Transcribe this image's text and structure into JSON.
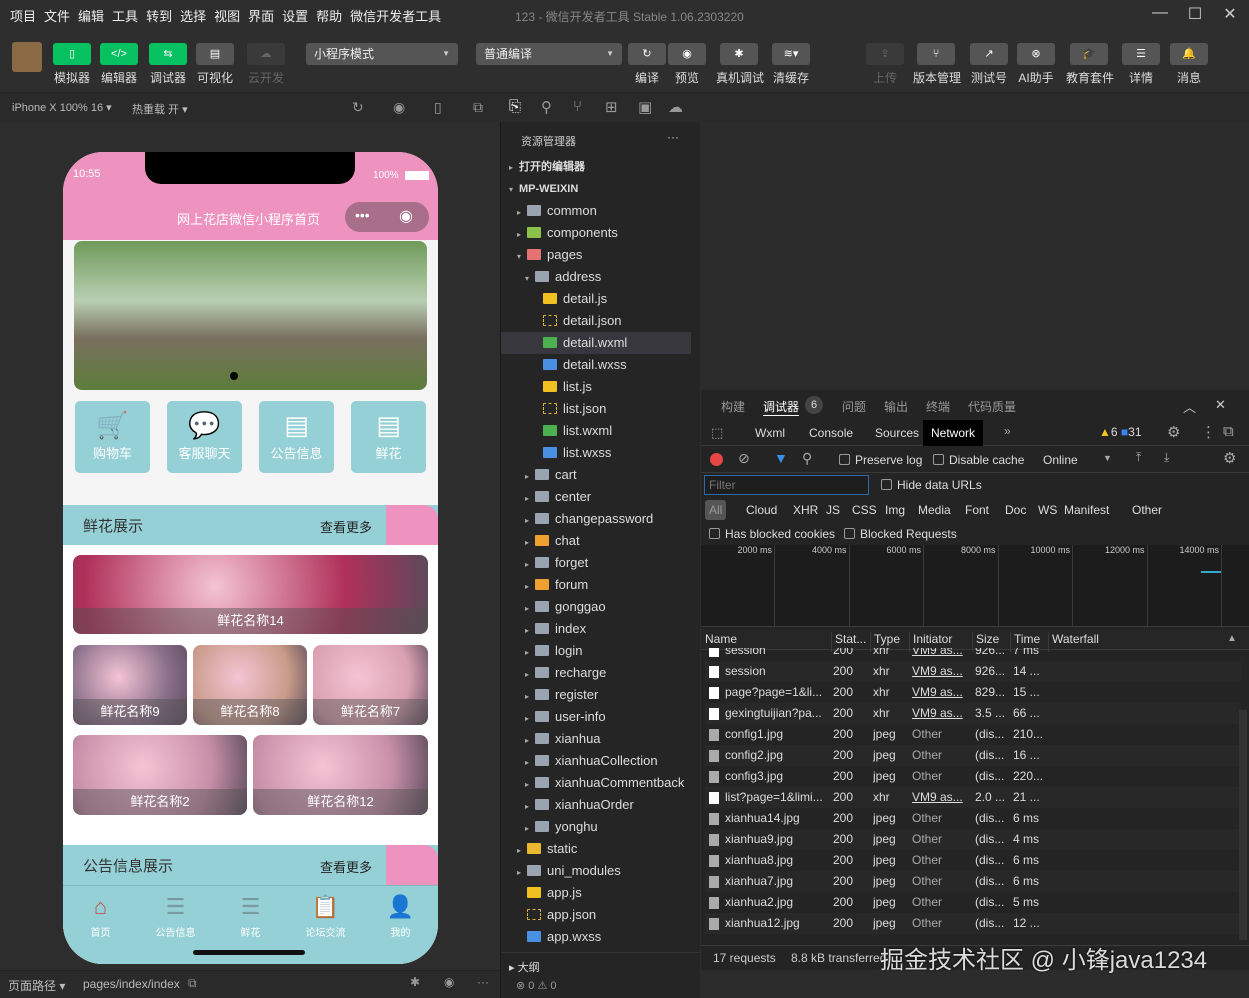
{
  "menu": [
    "项目",
    "文件",
    "编辑",
    "工具",
    "转到",
    "选择",
    "视图",
    "界面",
    "设置",
    "帮助",
    "微信开发者工具"
  ],
  "window_title": "123 - 微信开发者工具 Stable 1.06.2303220",
  "toolbar": {
    "left": [
      {
        "label": "模拟器",
        "icon": "phone-icon",
        "green": true
      },
      {
        "label": "编辑器",
        "icon": "code-icon",
        "green": true
      },
      {
        "label": "调试器",
        "icon": "debug-icon",
        "green": true
      },
      {
        "label": "可视化",
        "icon": "layout-icon"
      },
      {
        "label": "云开发",
        "icon": "cloud-icon",
        "disabled": true
      }
    ],
    "mode_select": "小程序模式",
    "compile_select": "普通编译",
    "mid": [
      {
        "label": "编译",
        "icon": "refresh-icon"
      },
      {
        "label": "预览",
        "icon": "eye-icon"
      },
      {
        "label": "真机调试",
        "icon": "bug-icon"
      },
      {
        "label": "清缓存",
        "icon": "layers-icon"
      }
    ],
    "right": [
      {
        "label": "上传",
        "icon": "upload-icon",
        "disabled": true
      },
      {
        "label": "版本管理",
        "icon": "branch-icon"
      },
      {
        "label": "测试号",
        "icon": "external-icon"
      },
      {
        "label": "AI助手",
        "icon": "ai-icon"
      },
      {
        "label": "教育套件",
        "icon": "graduation-icon"
      },
      {
        "label": "详情",
        "icon": "menu-icon"
      },
      {
        "label": "消息",
        "icon": "bell-icon"
      }
    ]
  },
  "simbar": {
    "device": "iPhone X 100% 16 ▾",
    "hotreload": "热重载 开 ▾"
  },
  "phone": {
    "time": "10:55",
    "battery": "100%",
    "title": "网上花店微信小程序首页",
    "tiles": [
      {
        "label": "购物车",
        "icon": "🛒"
      },
      {
        "label": "客服聊天",
        "icon": "💬"
      },
      {
        "label": "公告信息",
        "icon": "▤"
      },
      {
        "label": "鲜花",
        "icon": "▤"
      }
    ],
    "section1": {
      "title": "鲜花展示",
      "more": "查看更多"
    },
    "flowers": [
      "鲜花名称14",
      "鲜花名称9",
      "鲜花名称8",
      "鲜花名称7",
      "鲜花名称2",
      "鲜花名称12"
    ],
    "section2": {
      "title": "公告信息展示",
      "more": "查看更多"
    },
    "tabs": [
      {
        "label": "首页",
        "icon": "⌂"
      },
      {
        "label": "公告信息",
        "icon": "☰"
      },
      {
        "label": "鲜花",
        "icon": "☰"
      },
      {
        "label": "论坛交流",
        "icon": "📋"
      },
      {
        "label": "我的",
        "icon": "👤"
      }
    ],
    "colors": {
      "header": "#ee93c0",
      "accent": "#95d0d6"
    }
  },
  "explorer": {
    "title": "资源管理器",
    "more": "···",
    "tree": [
      {
        "label": "打开的编辑器",
        "depth": 0,
        "tw": "▸",
        "type": "section"
      },
      {
        "label": "MP-WEIXIN",
        "depth": 0,
        "tw": "▾",
        "type": "section"
      },
      {
        "label": "common",
        "depth": 1,
        "tw": "▸",
        "type": "folder"
      },
      {
        "label": "components",
        "depth": 1,
        "tw": "▸",
        "type": "folder-green"
      },
      {
        "label": "pages",
        "depth": 1,
        "tw": "▾",
        "type": "folder-red"
      },
      {
        "label": "address",
        "depth": 2,
        "tw": "▾",
        "type": "folder"
      },
      {
        "label": "detail.js",
        "depth": 3,
        "type": "js"
      },
      {
        "label": "detail.json",
        "depth": 3,
        "type": "json"
      },
      {
        "label": "detail.wxml",
        "depth": 3,
        "type": "wxml",
        "active": true
      },
      {
        "label": "detail.wxss",
        "depth": 3,
        "type": "wxss"
      },
      {
        "label": "list.js",
        "depth": 3,
        "type": "js"
      },
      {
        "label": "list.json",
        "depth": 3,
        "type": "json"
      },
      {
        "label": "list.wxml",
        "depth": 3,
        "type": "wxml"
      },
      {
        "label": "list.wxss",
        "depth": 3,
        "type": "wxss"
      },
      {
        "label": "cart",
        "depth": 2,
        "tw": "▸",
        "type": "folder"
      },
      {
        "label": "center",
        "depth": 2,
        "tw": "▸",
        "type": "folder"
      },
      {
        "label": "changepassword",
        "depth": 2,
        "tw": "▸",
        "type": "folder"
      },
      {
        "label": "chat",
        "depth": 2,
        "tw": "▸",
        "type": "folder-orange"
      },
      {
        "label": "forget",
        "depth": 2,
        "tw": "▸",
        "type": "folder"
      },
      {
        "label": "forum",
        "depth": 2,
        "tw": "▸",
        "type": "folder-orange"
      },
      {
        "label": "gonggao",
        "depth": 2,
        "tw": "▸",
        "type": "folder"
      },
      {
        "label": "index",
        "depth": 2,
        "tw": "▸",
        "type": "folder"
      },
      {
        "label": "login",
        "depth": 2,
        "tw": "▸",
        "type": "folder"
      },
      {
        "label": "recharge",
        "depth": 2,
        "tw": "▸",
        "type": "folder"
      },
      {
        "label": "register",
        "depth": 2,
        "tw": "▸",
        "type": "folder"
      },
      {
        "label": "user-info",
        "depth": 2,
        "tw": "▸",
        "type": "folder"
      },
      {
        "label": "xianhua",
        "depth": 2,
        "tw": "▸",
        "type": "folder"
      },
      {
        "label": "xianhuaCollection",
        "depth": 2,
        "tw": "▸",
        "type": "folder"
      },
      {
        "label": "xianhuaCommentback",
        "depth": 2,
        "tw": "▸",
        "type": "folder"
      },
      {
        "label": "xianhuaOrder",
        "depth": 2,
        "tw": "▸",
        "type": "folder"
      },
      {
        "label": "yonghu",
        "depth": 2,
        "tw": "▸",
        "type": "folder"
      },
      {
        "label": "static",
        "depth": 1,
        "tw": "▸",
        "type": "folder-yellow"
      },
      {
        "label": "uni_modules",
        "depth": 1,
        "tw": "▸",
        "type": "folder"
      },
      {
        "label": "app.js",
        "depth": 1,
        "type": "js"
      },
      {
        "label": "app.json",
        "depth": 1,
        "type": "json"
      },
      {
        "label": "app.wxss",
        "depth": 1,
        "type": "wxss"
      }
    ],
    "outline": "大纲",
    "problems": "⊗ 0 ⚠ 0"
  },
  "devtools": {
    "top_tabs": [
      "构建",
      "调试器",
      "问题",
      "输出",
      "终端",
      "代码质量"
    ],
    "debugger_badge": "6",
    "panels": [
      "Wxml",
      "Console",
      "Sources",
      "Network"
    ],
    "active_panel": "Network",
    "warnings": "6",
    "messages": "31",
    "preserve_log": "Preserve log",
    "disable_cache": "Disable cache",
    "throttle": "Online",
    "filter_placeholder": "Filter",
    "hide_data_urls": "Hide data URLs",
    "types": [
      "All",
      "Cloud",
      "XHR",
      "JS",
      "CSS",
      "Img",
      "Media",
      "Font",
      "Doc",
      "WS",
      "Manifest",
      "Other"
    ],
    "has_blocked": "Has blocked cookies",
    "blocked_requests": "Blocked Requests",
    "timeline": [
      "2000 ms",
      "4000 ms",
      "6000 ms",
      "8000 ms",
      "10000 ms",
      "12000 ms",
      "14000 ms"
    ],
    "columns": [
      "Name",
      "Stat...",
      "Type",
      "Initiator",
      "Size",
      "Time",
      "Waterfall"
    ],
    "rows": [
      [
        "session",
        "200",
        "xhr",
        "VM9 as...",
        "926...",
        "7 ms"
      ],
      [
        "session",
        "200",
        "xhr",
        "VM9 as...",
        "926...",
        "14 ..."
      ],
      [
        "page?page=1&li...",
        "200",
        "xhr",
        "VM9 as...",
        "829...",
        "15 ..."
      ],
      [
        "gexingtuijian?pa...",
        "200",
        "xhr",
        "VM9 as...",
        "3.5 ...",
        "66 ..."
      ],
      [
        "config1.jpg",
        "200",
        "jpeg",
        "Other",
        "(dis...",
        "210..."
      ],
      [
        "config2.jpg",
        "200",
        "jpeg",
        "Other",
        "(dis...",
        "16 ..."
      ],
      [
        "config3.jpg",
        "200",
        "jpeg",
        "Other",
        "(dis...",
        "220..."
      ],
      [
        "list?page=1&limi...",
        "200",
        "xhr",
        "VM9 as...",
        "2.0 ...",
        "21 ..."
      ],
      [
        "xianhua14.jpg",
        "200",
        "jpeg",
        "Other",
        "(dis...",
        "6 ms"
      ],
      [
        "xianhua9.jpg",
        "200",
        "jpeg",
        "Other",
        "(dis...",
        "4 ms"
      ],
      [
        "xianhua8.jpg",
        "200",
        "jpeg",
        "Other",
        "(dis...",
        "6 ms"
      ],
      [
        "xianhua7.jpg",
        "200",
        "jpeg",
        "Other",
        "(dis...",
        "6 ms"
      ],
      [
        "xianhua2.jpg",
        "200",
        "jpeg",
        "Other",
        "(dis...",
        "5 ms"
      ],
      [
        "xianhua12.jpg",
        "200",
        "jpeg",
        "Other",
        "(dis...",
        "12 ..."
      ]
    ],
    "summary_requests": "17 requests",
    "summary_transferred": "8.8 kB transferred"
  },
  "statusbar": {
    "path_label": "页面路径 ▾",
    "path": "pages/index/index"
  },
  "watermark": "掘金技术社区 @ 小锋java1234"
}
